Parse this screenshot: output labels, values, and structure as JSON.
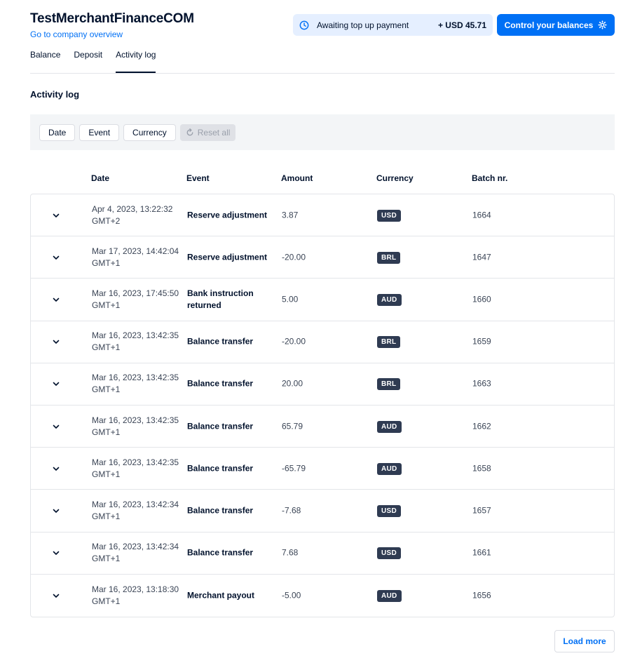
{
  "header": {
    "title": "TestMerchantFinanceCOM",
    "company_link": "Go to company overview",
    "status_text": "Awaiting top up payment",
    "status_amount": "+ USD 45.71",
    "control_button": "Control your balances"
  },
  "tabs": [
    {
      "label": "Balance",
      "active": false
    },
    {
      "label": "Deposit",
      "active": false
    },
    {
      "label": "Activity log",
      "active": true
    }
  ],
  "section_title": "Activity log",
  "filters": {
    "date": "Date",
    "event": "Event",
    "currency": "Currency",
    "reset": "Reset all"
  },
  "columns": {
    "date": "Date",
    "event": "Event",
    "amount": "Amount",
    "currency": "Currency",
    "batch": "Batch nr."
  },
  "rows": [
    {
      "date": "Apr 4, 2023, 13:22:32 GMT+2",
      "event": "Reserve adjustment",
      "amount": "3.87",
      "currency": "USD",
      "batch": "1664"
    },
    {
      "date": "Mar 17, 2023, 14:42:04 GMT+1",
      "event": "Reserve adjustment",
      "amount": "-20.00",
      "currency": "BRL",
      "batch": "1647"
    },
    {
      "date": "Mar 16, 2023, 17:45:50 GMT+1",
      "event": "Bank instruction returned",
      "amount": "5.00",
      "currency": "AUD",
      "batch": "1660"
    },
    {
      "date": "Mar 16, 2023, 13:42:35 GMT+1",
      "event": "Balance transfer",
      "amount": "-20.00",
      "currency": "BRL",
      "batch": "1659"
    },
    {
      "date": "Mar 16, 2023, 13:42:35 GMT+1",
      "event": "Balance transfer",
      "amount": "20.00",
      "currency": "BRL",
      "batch": "1663"
    },
    {
      "date": "Mar 16, 2023, 13:42:35 GMT+1",
      "event": "Balance transfer",
      "amount": "65.79",
      "currency": "AUD",
      "batch": "1662"
    },
    {
      "date": "Mar 16, 2023, 13:42:35 GMT+1",
      "event": "Balance transfer",
      "amount": "-65.79",
      "currency": "AUD",
      "batch": "1658"
    },
    {
      "date": "Mar 16, 2023, 13:42:34 GMT+1",
      "event": "Balance transfer",
      "amount": "-7.68",
      "currency": "USD",
      "batch": "1657"
    },
    {
      "date": "Mar 16, 2023, 13:42:34 GMT+1",
      "event": "Balance transfer",
      "amount": "7.68",
      "currency": "USD",
      "batch": "1661"
    },
    {
      "date": "Mar 16, 2023, 13:18:30 GMT+1",
      "event": "Merchant payout",
      "amount": "-5.00",
      "currency": "AUD",
      "batch": "1656"
    }
  ],
  "load_more": "Load more",
  "icons": {
    "status": "clock-icon",
    "control": "gear-icon",
    "reset": "refresh-icon",
    "row_toggle": "chevron-down-icon"
  },
  "colors": {
    "primary": "#0070f5",
    "text": "#00112c",
    "badge": "#2f3b52",
    "status_bg": "#e5efff"
  }
}
